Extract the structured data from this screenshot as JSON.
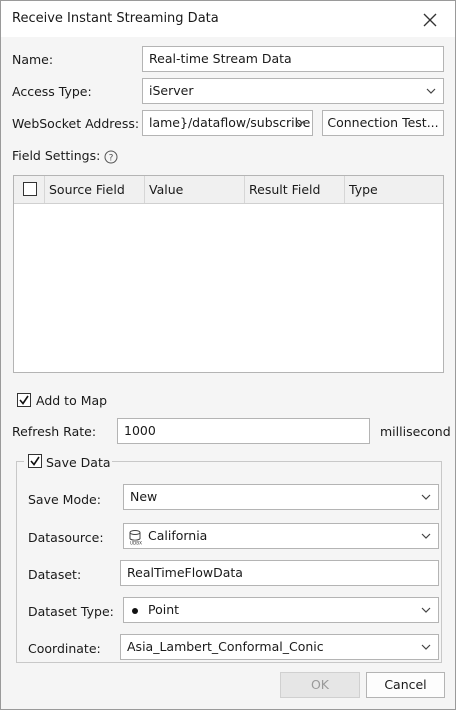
{
  "title": "Receive Instant Streaming Data",
  "name": {
    "label": "Name:",
    "value": "Real-time Stream Data"
  },
  "access_type": {
    "label": "Access Type:",
    "value": "iServer"
  },
  "websocket": {
    "label": "WebSocket Address:",
    "value": "lame}/dataflow/subscribe",
    "test_button": "Connection Test..."
  },
  "field_settings": {
    "label": "Field Settings:",
    "columns": [
      "Source Field",
      "Value",
      "Result Field",
      "Type"
    ],
    "rows": []
  },
  "add_to_map": {
    "label": "Add to Map",
    "checked": true
  },
  "refresh_rate": {
    "label": "Refresh Rate:",
    "value": "1000",
    "unit": "millisecond"
  },
  "save_data": {
    "label": "Save Data",
    "checked": true,
    "save_mode": {
      "label": "Save Mode:",
      "value": "New"
    },
    "datasource": {
      "label": "Datasource:",
      "value": "California",
      "icon": "udbx-datasource-icon"
    },
    "dataset": {
      "label": "Dataset:",
      "value": "RealTimeFlowData"
    },
    "dataset_type": {
      "label": "Dataset Type:",
      "value": "Point",
      "icon": "point-icon"
    },
    "coordinate": {
      "label": "Coordinate:",
      "value": "Asia_Lambert_Conformal_Conic"
    }
  },
  "buttons": {
    "ok": "OK",
    "cancel": "Cancel"
  }
}
